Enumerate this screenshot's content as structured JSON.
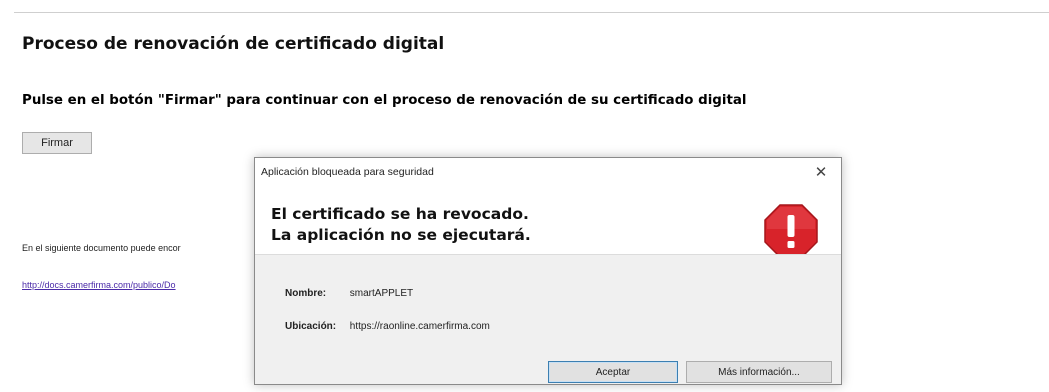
{
  "page": {
    "title": "Proceso de renovación de certificado digital",
    "instruction": "Pulse en el botón \"Firmar\" para continuar con el proceso de renovación de su certificado digital",
    "sign_button": "Firmar",
    "info_text": "En el siguiente documento puede encor",
    "info_link": "http://docs.camerfirma.com/publico/Do"
  },
  "dialog": {
    "title": "Aplicación bloqueada para seguridad",
    "message_line1": "El certificado se ha revocado.",
    "message_line2": "La aplicación no se ejecutará.",
    "name_label": "Nombre:",
    "name_value": "smartAPPLET",
    "location_label": "Ubicación:",
    "location_value": "https://raonline.camerfirma.com",
    "accept_button": "Aceptar",
    "more_info_button": "Más información...",
    "icon": "stop-error-icon",
    "close_icon": "close-icon",
    "accent_color": "#d8232a"
  }
}
